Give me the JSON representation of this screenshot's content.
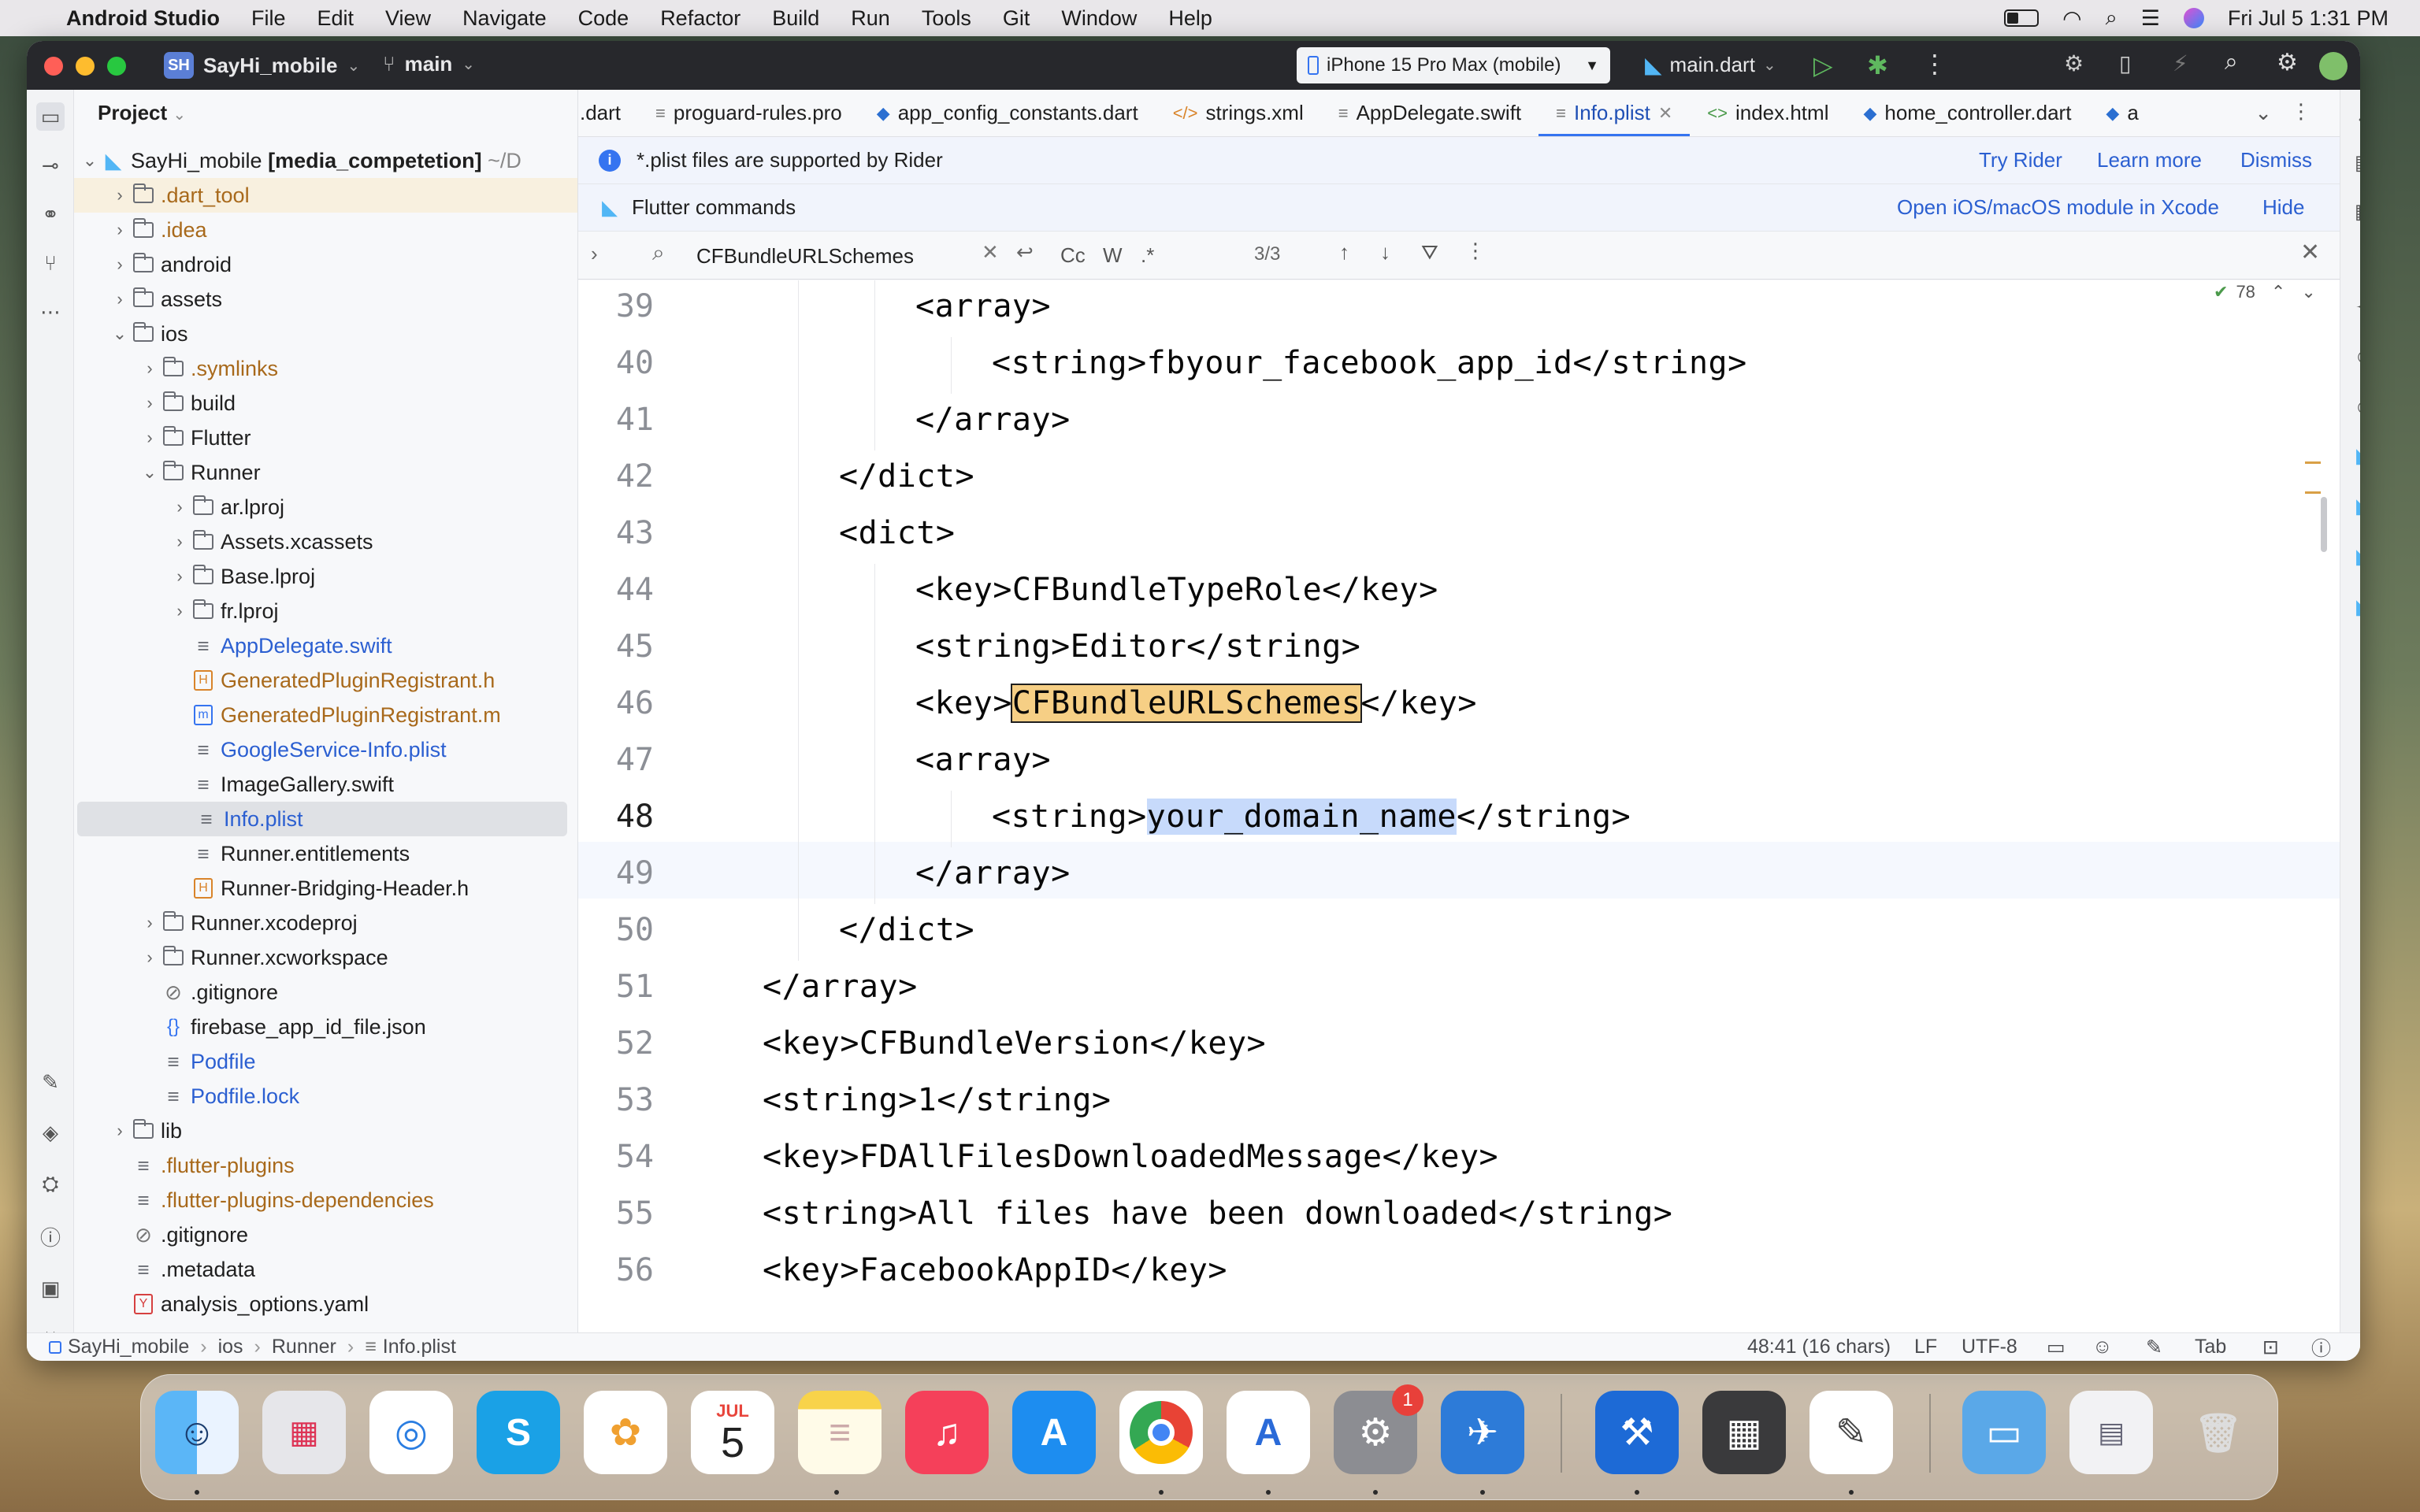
{
  "menubar": {
    "app": "Android Studio",
    "items": [
      "File",
      "Edit",
      "View",
      "Navigate",
      "Code",
      "Refactor",
      "Build",
      "Run",
      "Tools",
      "Git",
      "Window",
      "Help"
    ],
    "datetime": "Fri Jul 5  1:31 PM"
  },
  "titlebar": {
    "project_badge": "SH",
    "project": "SayHi_mobile",
    "branch": "main",
    "device": "iPhone 15 Pro Max (mobile)",
    "run_config": "main.dart"
  },
  "project_panel": {
    "title": "Project",
    "root": "SayHi_mobile",
    "root_module": "[media_competetion]",
    "root_path": "~/D",
    "rows": [
      {
        "label": ".dart_tool",
        "kind": "folder",
        "color": "#a8691b"
      },
      {
        "label": ".idea",
        "kind": "folder",
        "color": "#a8691b"
      },
      {
        "label": "android",
        "kind": "folder",
        "color": "#1f1f1f"
      },
      {
        "label": "assets",
        "kind": "folder",
        "color": "#1f1f1f"
      },
      {
        "label": "ios",
        "kind": "folder",
        "color": "#1f1f1f"
      },
      {
        "label": ".symlinks",
        "kind": "folder",
        "color": "#a8691b"
      },
      {
        "label": "build",
        "kind": "folder",
        "color": "#1f1f1f"
      },
      {
        "label": "Flutter",
        "kind": "folder",
        "color": "#1f1f1f"
      },
      {
        "label": "Runner",
        "kind": "folder",
        "color": "#1f1f1f"
      },
      {
        "label": "ar.lproj",
        "kind": "folder",
        "color": "#1f1f1f"
      },
      {
        "label": "Assets.xcassets",
        "kind": "folder",
        "color": "#1f1f1f"
      },
      {
        "label": "Base.lproj",
        "kind": "folder",
        "color": "#1f1f1f"
      },
      {
        "label": "fr.lproj",
        "kind": "folder",
        "color": "#1f1f1f"
      },
      {
        "label": "AppDelegate.swift",
        "kind": "file",
        "color": "#2b5fd1"
      },
      {
        "label": "GeneratedPluginRegistrant.h",
        "kind": "hfile",
        "color": "#a8691b"
      },
      {
        "label": "GeneratedPluginRegistrant.m",
        "kind": "mfile",
        "color": "#a8691b"
      },
      {
        "label": "GoogleService-Info.plist",
        "kind": "file",
        "color": "#2b5fd1"
      },
      {
        "label": "ImageGallery.swift",
        "kind": "file",
        "color": "#1f1f1f"
      },
      {
        "label": "Info.plist",
        "kind": "file",
        "color": "#2b5fd1"
      },
      {
        "label": "Runner.entitlements",
        "kind": "file",
        "color": "#1f1f1f"
      },
      {
        "label": "Runner-Bridging-Header.h",
        "kind": "hfile",
        "color": "#1f1f1f"
      },
      {
        "label": "Runner.xcodeproj",
        "kind": "folder",
        "color": "#1f1f1f"
      },
      {
        "label": "Runner.xcworkspace",
        "kind": "folder",
        "color": "#1f1f1f"
      },
      {
        "label": ".gitignore",
        "kind": "ignore",
        "color": "#1f1f1f"
      },
      {
        "label": "firebase_app_id_file.json",
        "kind": "json",
        "color": "#1f1f1f"
      },
      {
        "label": "Podfile",
        "kind": "file",
        "color": "#2b5fd1"
      },
      {
        "label": "Podfile.lock",
        "kind": "file",
        "color": "#2b5fd1"
      },
      {
        "label": "lib",
        "kind": "folder",
        "color": "#1f1f1f"
      },
      {
        "label": ".flutter-plugins",
        "kind": "file",
        "color": "#a8691b"
      },
      {
        "label": ".flutter-plugins-dependencies",
        "kind": "file",
        "color": "#a8691b"
      },
      {
        "label": ".gitignore",
        "kind": "ignore",
        "color": "#1f1f1f"
      },
      {
        "label": ".metadata",
        "kind": "file",
        "color": "#1f1f1f"
      },
      {
        "label": "analysis_options.yaml",
        "kind": "yaml",
        "color": "#1f1f1f"
      }
    ]
  },
  "tabs": [
    {
      "label": ".dart",
      "icon": "dart-icon"
    },
    {
      "label": "proguard-rules.pro",
      "icon": "file-icon"
    },
    {
      "label": "app_config_constants.dart",
      "icon": "dart-icon"
    },
    {
      "label": "strings.xml",
      "icon": "xml-icon"
    },
    {
      "label": "AppDelegate.swift",
      "icon": "file-icon"
    },
    {
      "label": "Info.plist",
      "icon": "file-icon",
      "active": true
    },
    {
      "label": "index.html",
      "icon": "html-icon"
    },
    {
      "label": "home_controller.dart",
      "icon": "dart-icon"
    },
    {
      "label": "a",
      "icon": "dart-icon"
    }
  ],
  "banner_plist": {
    "text": "*.plist files are supported by Rider",
    "try": "Try Rider",
    "learn": "Learn more",
    "dismiss": "Dismiss"
  },
  "banner_flutter": {
    "text": "Flutter commands",
    "open": "Open iOS/macOS module in Xcode",
    "hide": "Hide"
  },
  "find": {
    "query": "CFBundleURLSchemes",
    "count": "3/3",
    "opt_case": "Cc",
    "opt_word": "W",
    "opt_regex": ".*"
  },
  "editor": {
    "inspection_count": "78",
    "lines": [
      {
        "n": "39",
        "indent": 3,
        "text": "<array>"
      },
      {
        "n": "40",
        "indent": 4,
        "text": "<string>fbyour_facebook_app_id</string>"
      },
      {
        "n": "41",
        "indent": 3,
        "text": "</array>"
      },
      {
        "n": "42",
        "indent": 2,
        "text": "</dict>"
      },
      {
        "n": "43",
        "indent": 2,
        "text": "<dict>"
      },
      {
        "n": "44",
        "indent": 3,
        "text": "<key>CFBundleTypeRole</key>"
      },
      {
        "n": "45",
        "indent": 3,
        "text": "<string>Editor</string>"
      },
      {
        "n": "46",
        "indent": 3,
        "pre": "<key>",
        "match": "CFBundleURLSchemes",
        "post": "</key>"
      },
      {
        "n": "47",
        "indent": 3,
        "text": "<array>"
      },
      {
        "n": "48",
        "indent": 4,
        "pre": "<string>",
        "sel": "your_domain_name",
        "post": "</string>"
      },
      {
        "n": "49",
        "indent": 3,
        "text": "</array>"
      },
      {
        "n": "50",
        "indent": 2,
        "text": "</dict>"
      },
      {
        "n": "51",
        "indent": 1,
        "text": "</array>"
      },
      {
        "n": "52",
        "indent": 1,
        "text": "<key>CFBundleVersion</key>"
      },
      {
        "n": "53",
        "indent": 1,
        "text": "<string>1</string>"
      },
      {
        "n": "54",
        "indent": 1,
        "text": "<key>FDAllFilesDownloadedMessage</key>"
      },
      {
        "n": "55",
        "indent": 1,
        "text": "<string>All files have been downloaded</string>"
      },
      {
        "n": "56",
        "indent": 1,
        "text": "<key>FacebookAppID</key>"
      }
    ]
  },
  "statusbar": {
    "crumbs": [
      "SayHi_mobile",
      "ios",
      "Runner",
      "Info.plist"
    ],
    "position": "48:41 (16 chars)",
    "line_sep": "LF",
    "encoding": "UTF-8",
    "indent": "Tab"
  },
  "dock": {
    "calendar_month": "JUL",
    "calendar_day": "5",
    "settings_badge": "1",
    "apps": [
      "Finder",
      "Launchpad",
      "Safari",
      "Skype",
      "Photos",
      "Calendar",
      "Notes",
      "Music",
      "App Store",
      "Chrome",
      "Android Studio",
      "System Settings",
      "Xcode Simulator",
      "Xcode",
      "Calculator",
      "TextEdit",
      "Downloads",
      "Screenshot",
      "Trash"
    ]
  }
}
